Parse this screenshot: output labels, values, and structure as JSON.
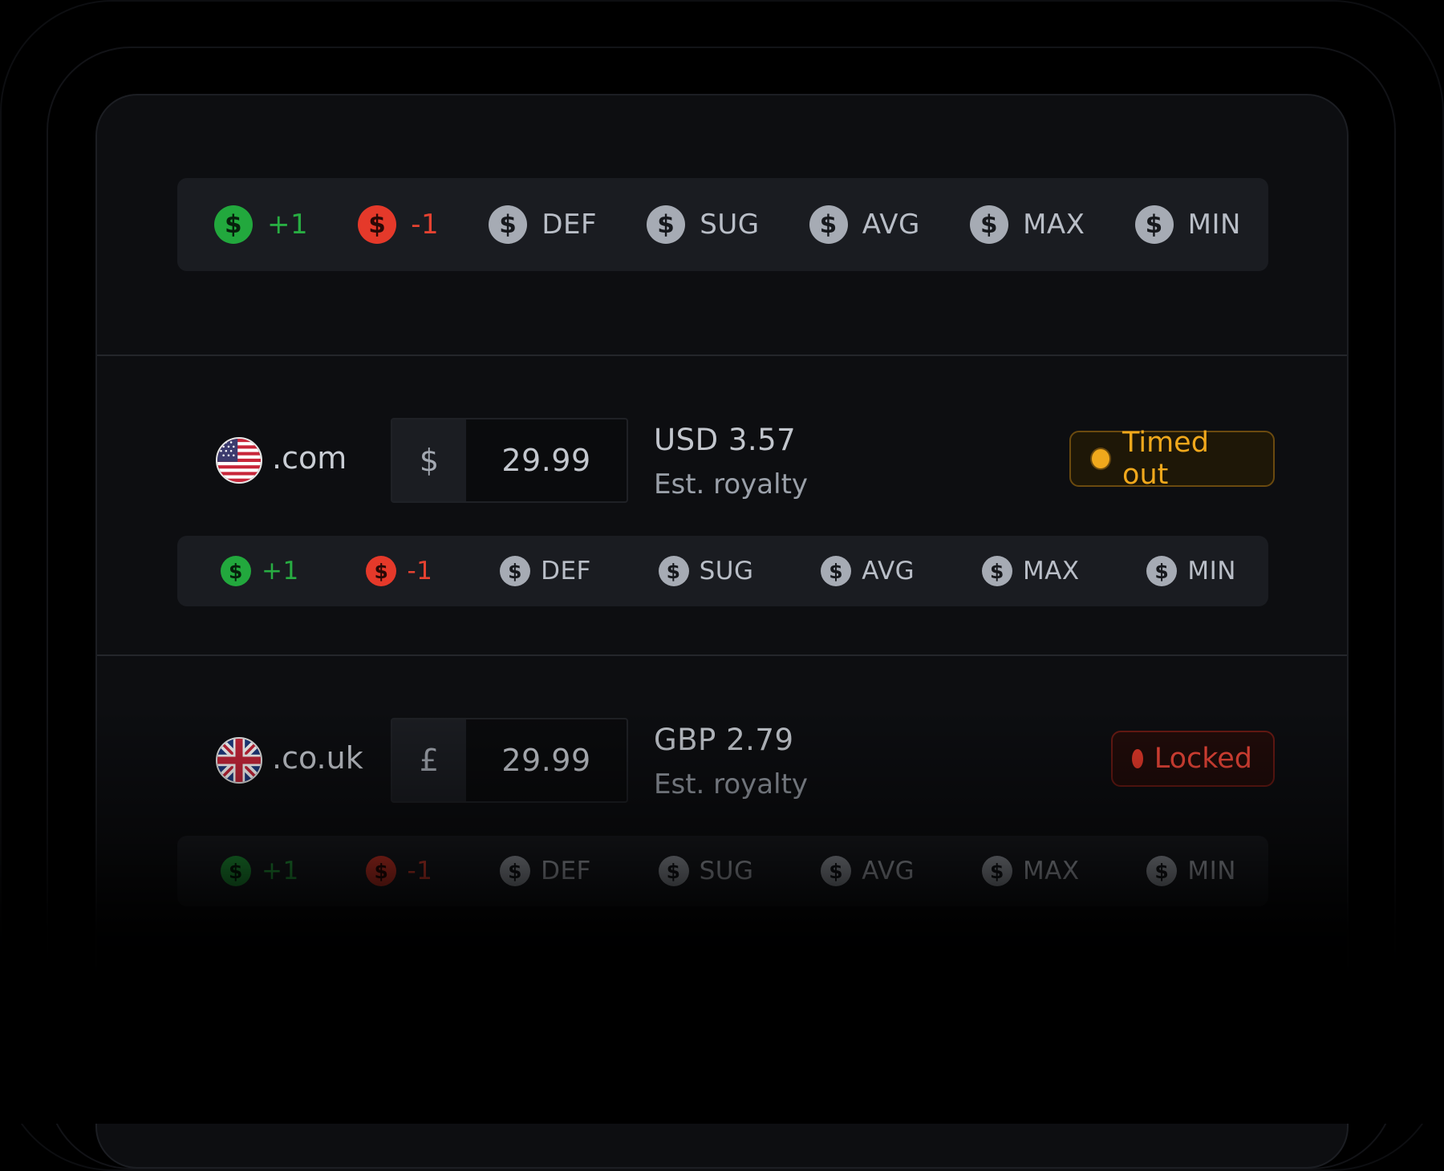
{
  "toolbar_buttons": [
    {
      "key": "plus",
      "label": "+1",
      "tone": "green"
    },
    {
      "key": "minus",
      "label": "-1",
      "tone": "red"
    },
    {
      "key": "def",
      "label": "DEF",
      "tone": "neutral"
    },
    {
      "key": "sug",
      "label": "SUG",
      "tone": "neutral"
    },
    {
      "key": "avg",
      "label": "AVG",
      "tone": "neutral"
    },
    {
      "key": "max",
      "label": "MAX",
      "tone": "neutral"
    },
    {
      "key": "min",
      "label": "MIN",
      "tone": "neutral"
    }
  ],
  "coin_symbol": "$",
  "markets": [
    {
      "domain": ".com",
      "flag": "us-flag-icon",
      "currency_symbol": "$",
      "price": "29.99",
      "royalty_value": "USD 3.57",
      "royalty_label": "Est. royalty",
      "status": "Timed out",
      "status_color": "#f0a81c"
    },
    {
      "domain": ".co.uk",
      "flag": "uk-flag-icon",
      "currency_symbol": "£",
      "price": "29.99",
      "royalty_value": "GBP 2.79",
      "royalty_label": "Est. royalty",
      "status": "Locked",
      "status_color": "#e5392a"
    }
  ],
  "colors": {
    "positive": "#22a83d",
    "negative": "#e5392a",
    "warning": "#f0a81c",
    "background": "#0d0e11"
  }
}
